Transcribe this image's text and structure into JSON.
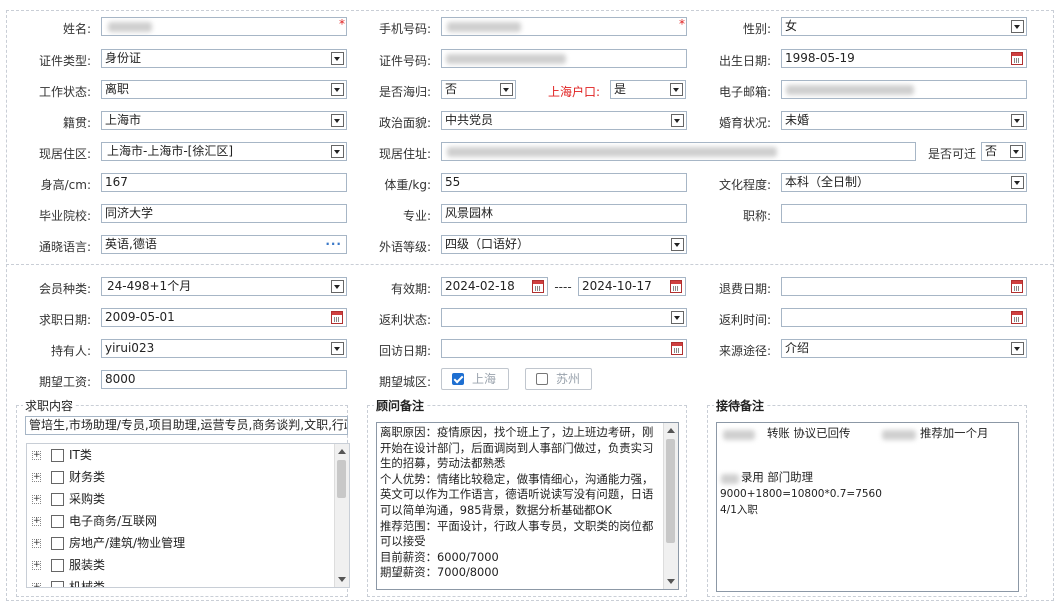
{
  "basic": {
    "name_label": "姓名:",
    "phone_label": "手机号码:",
    "gender_label": "性别:",
    "gender_value": "女",
    "idtype_label": "证件类型:",
    "idtype_value": "身份证",
    "idno_label": "证件号码:",
    "birth_label": "出生日期:",
    "birth_value": "1998-05-19",
    "workstatus_label": "工作状态:",
    "workstatus_value": "离职",
    "returnee_label": "是否海归:",
    "returnee_value": "否",
    "hukou_label": "上海户口:",
    "hukou_value": "是",
    "email_label": "电子邮箱:",
    "native_label": "籍贯:",
    "native_value": "上海市",
    "political_label": "政治面貌:",
    "political_value": "中共党员",
    "marital_label": "婚育状况:",
    "marital_value": "未婚",
    "residence_area_label": "现居住区:",
    "residence_area_value": "上海市-上海市-[徐汇区]",
    "address_label": "现居住址:",
    "relocate_label": "是否可迁",
    "relocate_value": "否",
    "height_label": "身高/cm:",
    "height_value": "167",
    "weight_label": "体重/kg:",
    "weight_value": "55",
    "education_label": "文化程度:",
    "education_value": "本科（全日制）",
    "school_label": "毕业院校:",
    "school_value": "同济大学",
    "major_label": "专业:",
    "major_value": "风景园林",
    "title_label": "职称:",
    "title_value": "",
    "language_label": "通晓语言:",
    "language_value": "英语,德语",
    "language_level_label": "外语等级:",
    "language_level_value": "四级（口语好）"
  },
  "member": {
    "type_label": "会员种类:",
    "type_value": "24-498+1个月",
    "valid_label": "有效期:",
    "valid_from": "2024-02-18",
    "valid_sep": "----",
    "valid_to": "2024-10-17",
    "refund_label": "退费日期:",
    "job_date_label": "求职日期:",
    "job_date_value": "2009-05-01",
    "rebate_status_label": "返利状态:",
    "rebate_time_label": "返利时间:",
    "holder_label": "持有人:",
    "holder_value": "yirui023",
    "visit_label": "回访日期:",
    "source_label": "来源途径:",
    "source_value": "介绍",
    "salary_label": "期望工资:",
    "salary_value": "8000",
    "city_label": "期望城区:",
    "cities": [
      {
        "label": "上海",
        "checked": true
      },
      {
        "label": "苏州",
        "checked": false
      }
    ]
  },
  "job_content": {
    "title": "求职内容",
    "summary": "管培生,市场助理/专员,项目助理,运营专员,商务谈判,文职,行政",
    "tree": [
      "IT类",
      "财务类",
      "采购类",
      "电子商务/互联网",
      "房地产/建筑/物业管理",
      "服装类",
      "机械类"
    ]
  },
  "advisor_note": {
    "title": "顾问备注",
    "text": "离职原因：疫情原因，找个班上了，边上班边考研，刚开始在设计部门，后面调岗到人事部门做过，负责实习生的招募，劳动法都熟悉\n个人优势：情绪比较稳定，做事情细心，沟通能力强，英文可以作为工作语言，德语听说读写没有问题，日语可以简单沟通，985背景，数据分析基础都OK\n推荐范围：平面设计，行政人事专员，文职类的岗位都可以接受\n目前薪资：6000/7000\n期望薪资：7000/8000"
  },
  "reception_note": {
    "title": "接待备注",
    "line1_a": "转账  协议已回传",
    "line1_b": "推荐加一个月",
    "line2": "录用  部门助理",
    "line3": "9000+1800=10800*0.7=7560",
    "line4": "4/1入职"
  }
}
